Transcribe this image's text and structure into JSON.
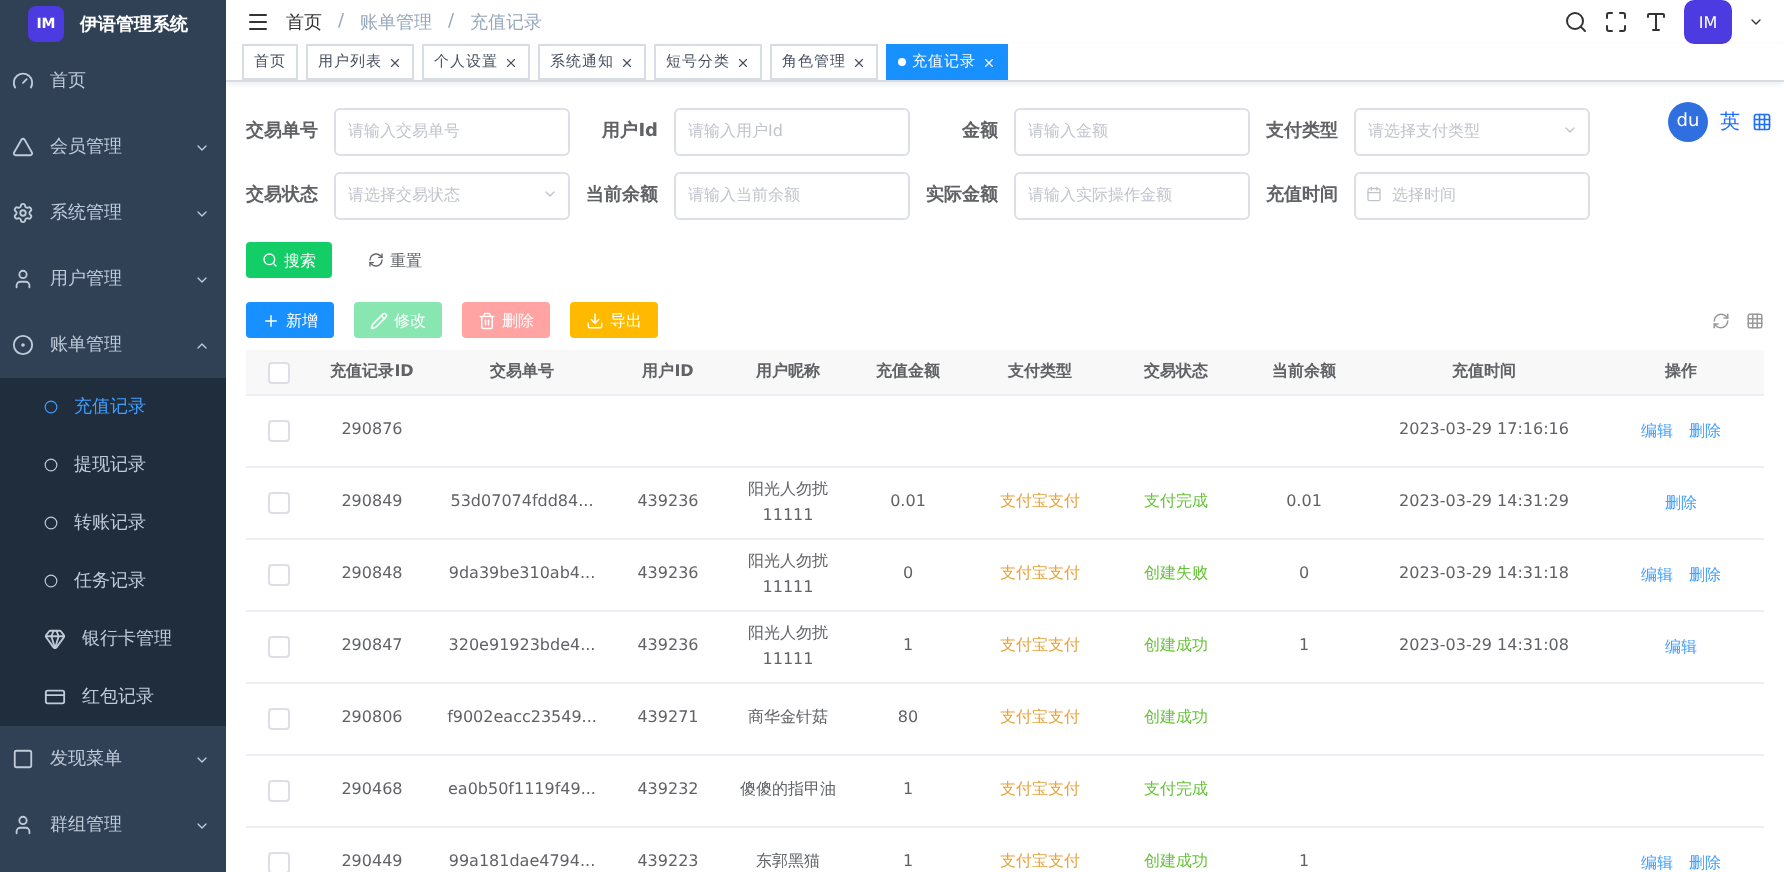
{
  "app": {
    "title": "伊语管理系统",
    "logo": "IM"
  },
  "sidebar": {
    "items": [
      {
        "label": "首页"
      },
      {
        "label": "会员管理",
        "expanded": false
      },
      {
        "label": "系统管理",
        "expanded": false
      },
      {
        "label": "用户管理",
        "expanded": false
      },
      {
        "label": "账单管理",
        "expanded": true,
        "children": [
          {
            "label": "充值记录",
            "selected": true
          },
          {
            "label": "提现记录",
            "selected": false
          },
          {
            "label": "转账记录",
            "selected": false
          },
          {
            "label": "任务记录",
            "selected": false
          },
          {
            "label": "银行卡管理",
            "selected": false
          },
          {
            "label": "红包记录",
            "selected": false
          }
        ]
      },
      {
        "label": "发现菜单",
        "expanded": false
      },
      {
        "label": "群组管理",
        "expanded": false
      }
    ]
  },
  "avatar": {
    "label": "IM"
  },
  "breadcrumb": [
    {
      "label": "首页"
    },
    {
      "separator": "/",
      "label": "账单管理"
    },
    {
      "separator": "/",
      "label": "充值记录"
    }
  ],
  "tabs": [
    {
      "label": "首页",
      "closable": false,
      "selected": false
    },
    {
      "label": "用户列表",
      "closable": true,
      "selected": false
    },
    {
      "label": "个人设置",
      "closable": true,
      "selected": false
    },
    {
      "label": "系统通知",
      "closable": true,
      "selected": false
    },
    {
      "label": "短号分类",
      "closable": true,
      "selected": false
    },
    {
      "label": "角色管理",
      "closable": true,
      "selected": false
    },
    {
      "label": "充值记录",
      "closable": true,
      "selected": true
    }
  ],
  "filters": [
    {
      "label": "交易单号",
      "placeholder": "请输入交易单号",
      "kind": "text"
    },
    {
      "label": "用户Id",
      "placeholder": "请输入用户Id",
      "kind": "text"
    },
    {
      "label": "金额",
      "placeholder": "请输入金额",
      "kind": "text"
    },
    {
      "label": "支付类型",
      "placeholder": "请选择支付类型",
      "kind": "select"
    },
    {
      "label": "交易状态",
      "placeholder": "请选择交易状态",
      "kind": "select"
    },
    {
      "label": "当前余额",
      "placeholder": "请输入当前余额",
      "kind": "text"
    },
    {
      "label": "实际金额",
      "placeholder": "请输入实际操作金额",
      "kind": "text"
    },
    {
      "label": "充值时间",
      "placeholder": "选择时间",
      "kind": "date"
    }
  ],
  "search_button": "搜索",
  "reset_button": "重置",
  "ime_toolbar": {
    "logo": "du",
    "mode": "英"
  },
  "actions": [
    {
      "label": "新增",
      "kind": "primary",
      "disabled": false
    },
    {
      "label": "修改",
      "kind": "success",
      "disabled": true
    },
    {
      "label": "删除",
      "kind": "danger",
      "disabled": true
    },
    {
      "label": "导出",
      "kind": "warning",
      "disabled": false
    }
  ],
  "table": {
    "all_selected": false,
    "columns": [
      "充值记录ID",
      "交易单号",
      "用户ID",
      "用户昵称",
      "充值金额",
      "支付类型",
      "交易状态",
      "当前余额",
      "充值时间",
      "操作"
    ],
    "rows": [
      {
        "selected": false,
        "cells": [
          "290876",
          "",
          "",
          "",
          "",
          "",
          "",
          "",
          "2023-03-29 17:16:16"
        ],
        "ops": [
          "编辑",
          "删除"
        ]
      },
      {
        "selected": false,
        "cells": [
          "290849",
          "53d07074fdd84...",
          "439236",
          "阳光人勿扰11111",
          "0.01",
          "支付宝支付",
          "支付完成",
          "0.01",
          "2023-03-29 14:31:29"
        ],
        "ops": [
          "删除"
        ]
      },
      {
        "selected": false,
        "cells": [
          "290848",
          "9da39be310ab4...",
          "439236",
          "阳光人勿扰11111",
          "0",
          "支付宝支付",
          "创建失败",
          "0",
          "2023-03-29 14:31:18"
        ],
        "ops": [
          "编辑",
          "删除"
        ]
      },
      {
        "selected": false,
        "cells": [
          "290847",
          "320e91923bde4...",
          "439236",
          "阳光人勿扰11111",
          "1",
          "支付宝支付",
          "创建成功",
          "1",
          "2023-03-29 14:31:08"
        ],
        "ops": [
          "编辑"
        ]
      },
      {
        "selected": false,
        "cells": [
          "290806",
          "f9002eacc23549...",
          "439271",
          "商华金针菇",
          "80",
          "支付宝支付",
          "创建成功",
          "",
          ""
        ],
        "ops": []
      },
      {
        "selected": false,
        "cells": [
          "290468",
          "ea0b50f1119f49...",
          "439232",
          "傻傻的指甲油",
          "1",
          "支付宝支付",
          "支付完成",
          "",
          ""
        ],
        "ops": []
      },
      {
        "selected": false,
        "cells": [
          "290449",
          "99a181dae4794...",
          "439223",
          "东郭黑猫",
          "1",
          "支付宝支付",
          "创建成功",
          "1",
          ""
        ],
        "ops": [
          "编辑",
          "删除"
        ]
      }
    ]
  }
}
